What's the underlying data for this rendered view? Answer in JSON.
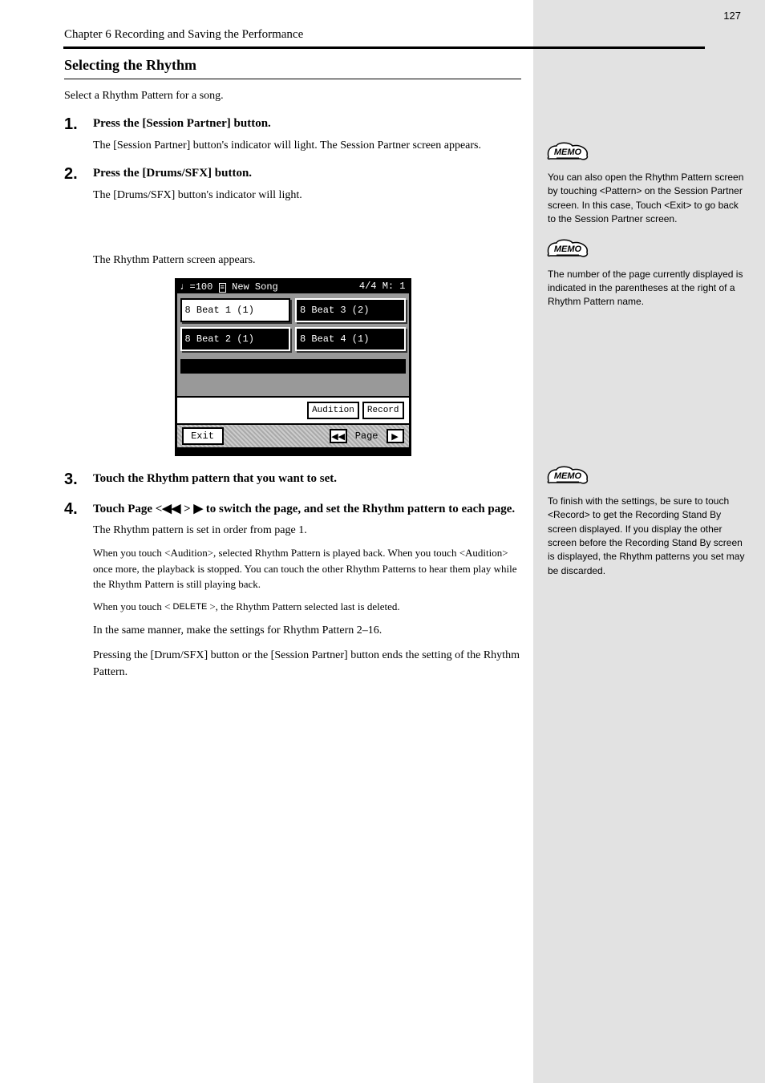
{
  "page": {
    "number": "127",
    "running_head": "Chapter 6 Recording and Saving the Performance"
  },
  "section": {
    "heading": "Selecting the Rhythm"
  },
  "intro": "Select a Rhythm Pattern for a song.",
  "steps": {
    "s1": {
      "label": "Press the [Session Partner] button.",
      "body": "The [Session Partner] button's indicator will light. The Session Partner screen appears."
    },
    "s2": {
      "label": "Press the [Drums/SFX] button.",
      "body": "The [Drums/SFX] button's indicator will light.",
      "tail": "The Rhythm Pattern screen appears."
    },
    "s3": {
      "label": "Touch the Rhythm pattern that you want to set."
    },
    "s4": {
      "label_pre": "Touch Page <",
      "label_mid": " >",
      "label_post": " to switch the page, and set the Rhythm pattern to each page.",
      "body1": "The Rhythm pattern is set in order from page 1.",
      "audition": "When you touch <Audition>, selected Rhythm Pattern is played back. When you touch <Audition> once more, the playback is stopped. You can touch the other Rhythm Patterns to hear them play while the Rhythm Pattern is still playing back.",
      "body2_pre": "When you touch <",
      "body2_post": ">, the Rhythm Pattern selected last is deleted.",
      "body3": "In the same manner, make the settings for Rhythm Pattern 2–16.",
      "body4": "Pressing the [Drum/SFX] button or the [Session Partner] button ends the setting of the Rhythm Pattern.",
      "inline_btn": "DELETE",
      "page_prev": "◀◀",
      "page_next": "▶"
    }
  },
  "ui": {
    "header_left": "=100",
    "header_song": "New Song",
    "header_right": "4/4  M:  1",
    "btn1": "8 Beat 1 (1)",
    "btn2": "8 Beat 3 (2)",
    "btn3": "8 Beat 2 (1)",
    "btn4": "8 Beat 4 (1)",
    "audition": "Audition",
    "record": "Record",
    "exit": "Exit",
    "page": "Page"
  },
  "memo": {
    "m1": "You can also open the Rhythm Pattern screen by touching <Pattern> on the Session Partner screen. In this case, Touch <Exit> to go back to the Session Partner screen.",
    "m2": "The number of the page currently displayed is indicated in the parentheses at the right of a Rhythm Pattern name.",
    "m3": "To finish with the settings, be sure to touch <Record> to get the Recording Stand By screen displayed. If you display the other screen before the Recording Stand By screen is displayed, the Rhythm patterns you set may be discarded."
  }
}
